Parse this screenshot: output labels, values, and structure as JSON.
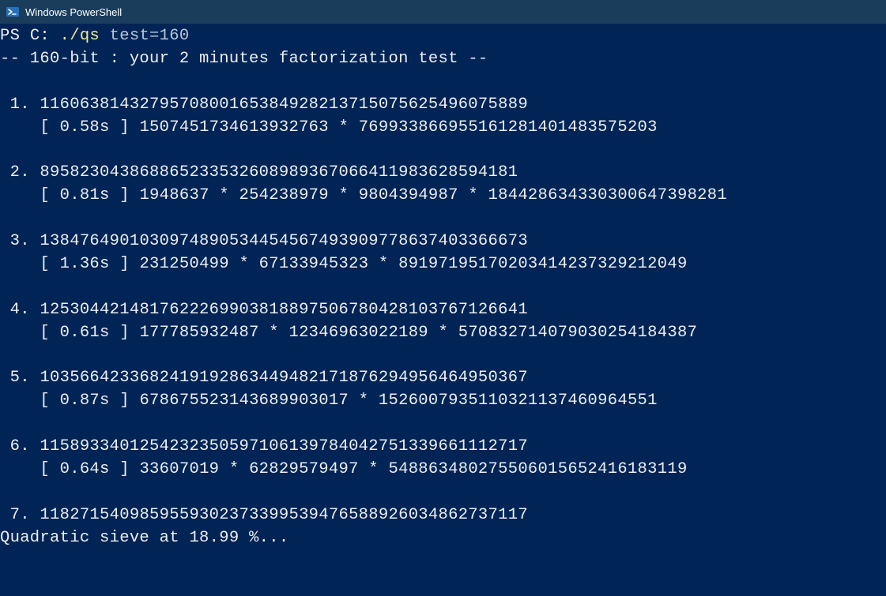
{
  "window": {
    "title": "Windows PowerShell"
  },
  "prompt": {
    "ps": "PS ",
    "path": "C: ",
    "command": "./qs",
    "arg": " test=160"
  },
  "header_line": "-- 160-bit : your 2 minutes factorization test --",
  "results": [
    {
      "idx": " 1.",
      "n": "1160638143279570800165384928213715075625496075889",
      "time": "0.58s",
      "factors": "1507451734613932763 * 769933866955161281401483575203"
    },
    {
      "idx": " 2.",
      "n": "895823043868865233532608989367066411983628594181",
      "time": "0.81s",
      "factors": "1948637 * 254238979 * 9804394987 * 184428634330300647398281"
    },
    {
      "idx": " 3.",
      "n": "1384764901030974890534454567493909778637403366673",
      "time": "1.36s",
      "factors": "231250499 * 67133945323 * 89197195170203414237329212049"
    },
    {
      "idx": " 4.",
      "n": "1253044214817622269903818897506780428103767126641",
      "time": "0.61s",
      "factors": "177785932487 * 12346963022189 * 570832714079030254184387"
    },
    {
      "idx": " 5.",
      "n": "1035664233682419192863449482171876294956464950367",
      "time": "0.87s",
      "factors": "678675523143689903017 * 1526007935110321137460964551"
    },
    {
      "idx": " 6.",
      "n": "1158933401254232350597106139784042751339661112717",
      "time": "0.64s",
      "factors": "33607019 * 62829579497 * 548863480275506015652416183119"
    }
  ],
  "pending": {
    "idx": " 7.",
    "n": "1182715409859559302373399539476588926034862737117"
  },
  "status": "Quadratic sieve at 18.99 %..."
}
